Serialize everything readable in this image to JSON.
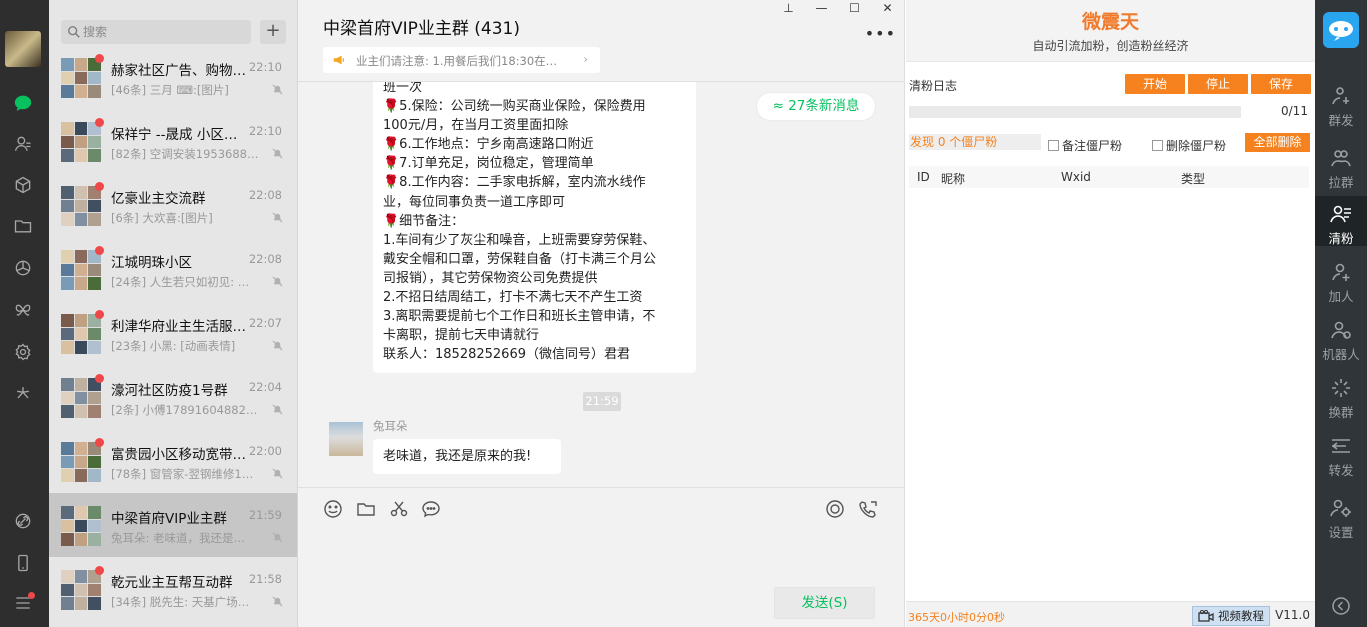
{
  "left_nav": {
    "icons": [
      "chat-icon",
      "contacts-icon",
      "box-icon",
      "folder-icon",
      "moments-icon",
      "butterfly-icon",
      "gear-icon",
      "spark-icon",
      "link-icon",
      "phone-icon",
      "menu-icon"
    ]
  },
  "chatlist": {
    "search_placeholder": "搜索",
    "add_label": "+",
    "items": [
      {
        "name": "赫家社区广告、购物…",
        "time": "22:10",
        "preview": "[46条] 三月 ⌨:[图片]"
      },
      {
        "name": "保祥宁 --晟成 小区…",
        "time": "22:10",
        "preview": "[82条] 空调安装1953688…"
      },
      {
        "name": "亿豪业主交流群",
        "time": "22:08",
        "preview": "[6条] 大欢喜:[图片]"
      },
      {
        "name": "江城明珠小区",
        "time": "22:08",
        "preview": "[24条] 人生若只如初见: …"
      },
      {
        "name": "利津华府业主生活服…",
        "time": "22:07",
        "preview": "[23条] 小黑: [动画表情]"
      },
      {
        "name": "濠河社区防疫1号群",
        "time": "22:04",
        "preview": "[2条] 小傅17891604882…"
      },
      {
        "name": "富贵园小区移动宽带…",
        "time": "22:00",
        "preview": "[78条] 窗管家-翌钢维修1…"
      },
      {
        "name": "中梁首府VIP业主群",
        "time": "21:59",
        "preview": "兔耳朵: 老味道，我还是…"
      },
      {
        "name": "乾元业主互帮互动群",
        "time": "21:58",
        "preview": "[34条] 脱先生: 天基广场…"
      }
    ]
  },
  "chat": {
    "title": "中梁首府VIP业主群 (431)",
    "window_buttons": [
      "⊥",
      "—",
      "☐",
      "✕"
    ],
    "more": "•••",
    "notice": "业主们请注意:  1.用餐后我们18:30在…",
    "new_messages": "≈ 27条新消息",
    "message_lines": [
      "班一次",
      "🌹5.保险：公司统一购买商业保险，保险费用",
      "100元/月，在当月工资里面扣除",
      "🌹6.工作地点：宁乡南高速路口附近",
      "🌹7.订单充足，岗位稳定，管理简单",
      "🌹8.工作内容：二手家电拆解，室内流水线作",
      "业，每位同事负责一道工序即可",
      "🌹细节备注：",
      "1.车间有少了灰尘和噪音，上班需要穿劳保鞋、",
      "戴安全帽和口罩，劳保鞋自备（打卡满三个月公",
      "司报销），其它劳保物资公司免费提供",
      "2.不招日结周结工，打卡不满七天不产生工资",
      "3.离职需要提前七个工作日和班长主管申请，不",
      "卡离职，提前七天申请就行",
      "联系人：18528252669（微信同号）君君"
    ],
    "time_chip": "21:59",
    "sender_name": "兔耳朵",
    "bubble_text": "老味道，我还是原来的我!",
    "send_label": "发送(S)"
  },
  "plugin": {
    "title": "微震天",
    "subtitle": "自动引流加粉，创造粉丝经济",
    "log_label": "清粉日志",
    "start_label": "开始",
    "stop_label": "停止",
    "save_label": "保存",
    "progress_fraction": 0,
    "progress_count": "0/11",
    "zombie_label": "发现 0 个僵尸粉",
    "remark_label": "备注僵尸粉",
    "delete_zombie_label": "删除僵尸粉",
    "delete_all_label": "全部删除",
    "columns": [
      "ID",
      "昵称",
      "Wxid",
      "类型"
    ],
    "uptime": "365天0小时0分0秒",
    "video_label": "视频教程",
    "version": "V11.0"
  },
  "rightbar": {
    "items": [
      "群发",
      "拉群",
      "清粉",
      "加人",
      "机器人",
      "换群",
      "转发",
      "设置"
    ],
    "active": "清粉"
  }
}
